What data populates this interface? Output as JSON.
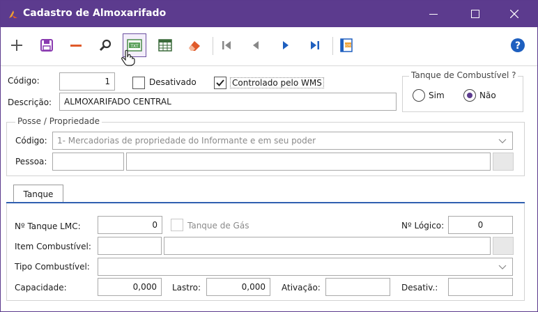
{
  "window": {
    "title": "Cadastro de Almoxarifado",
    "controls": {
      "minimize": "—",
      "maximize": "☐",
      "close": "✕"
    }
  },
  "toolbar": {
    "buttons": [
      {
        "name": "add-icon",
        "glyph": "+"
      },
      {
        "name": "save-icon",
        "glyph": ""
      },
      {
        "name": "remove-icon",
        "glyph": "—"
      },
      {
        "name": "search-icon",
        "glyph": ""
      },
      {
        "name": "txt-export-icon",
        "glyph": "TXT"
      },
      {
        "name": "grid-icon",
        "glyph": ""
      },
      {
        "name": "eraser-icon",
        "glyph": ""
      },
      {
        "name": "first-record-icon",
        "glyph": ""
      },
      {
        "name": "prev-record-icon",
        "glyph": ""
      },
      {
        "name": "next-record-icon",
        "glyph": ""
      },
      {
        "name": "last-record-icon",
        "glyph": ""
      },
      {
        "name": "log-icon",
        "glyph": "LOG"
      }
    ],
    "help_glyph": "?"
  },
  "form": {
    "codigo_label": "Código:",
    "codigo_value": "1",
    "desativado_label": "Desativado",
    "controlado_label": "Controlado pelo WMS",
    "descricao_label": "Descrição:",
    "descricao_value": "ALMOXARIFADO CENTRAL"
  },
  "tanque_group": {
    "title": "Tanque de Combustível ?",
    "sim_label": "Sim",
    "nao_label": "Não",
    "selected": "Não"
  },
  "posse": {
    "title": "Posse / Propriedade",
    "codigo_label": "Código:",
    "codigo_value": "1- Mercadorias de propriedade do Informante e em seu poder",
    "pessoa_label": "Pessoa:"
  },
  "tab": {
    "label": "Tanque"
  },
  "tanque": {
    "lmc_label": "Nº Tanque LMC:",
    "lmc_value": "0",
    "gas_label": "Tanque de Gás",
    "logico_label": "Nº Lógico:",
    "logico_value": "0",
    "item_label": "Item Combustível:",
    "tipo_label": "Tipo Combustível:",
    "capacidade_label": "Capacidade:",
    "capacidade_value": "0,000",
    "lastro_label": "Lastro:",
    "lastro_value": "0,000",
    "ativacao_label": "Ativação:",
    "desativ_label": "Desativ.:"
  },
  "colors": {
    "titlebar": "#5c3b8e",
    "accent_blue": "#2f5fb0",
    "icon_purple": "#7a4fb5",
    "icon_red": "#e05a2a"
  }
}
